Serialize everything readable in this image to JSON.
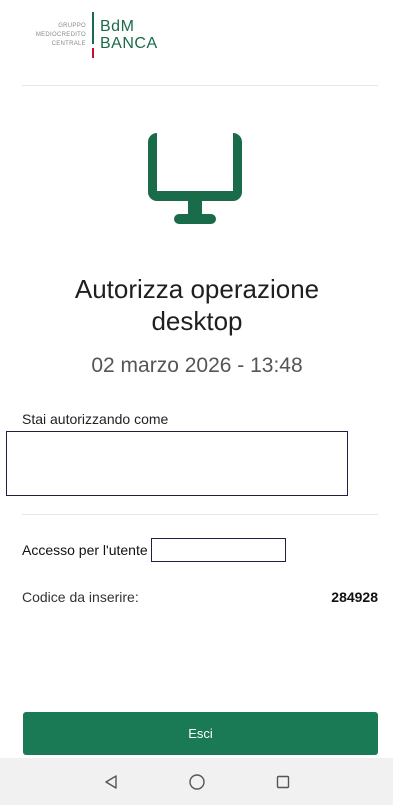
{
  "logo": {
    "group_line1": "GRUPPO",
    "group_line2": "MEDIOCREDITO",
    "group_line3": "CENTRALE",
    "brand_line1": "BdM",
    "brand_line2": "BANCA"
  },
  "header": {
    "title_line1": "Autorizza operazione",
    "title_line2": "desktop",
    "datetime": "02 marzo 2026 - 13:48"
  },
  "authorizing": {
    "label": "Stai autorizzando come"
  },
  "access": {
    "label": "Accesso per l'utente"
  },
  "code": {
    "label": "Codice da inserire:",
    "value": "284928"
  },
  "actions": {
    "exit_label": "Esci"
  },
  "icons": {
    "monitor": "desktop-monitor-icon",
    "nav_back": "back-triangle-icon",
    "nav_home": "home-circle-icon",
    "nav_recents": "recents-square-icon"
  },
  "colors": {
    "brand_green": "#1a6b4a",
    "button_green": "#1a7a55",
    "brand_red": "#c8102e"
  }
}
